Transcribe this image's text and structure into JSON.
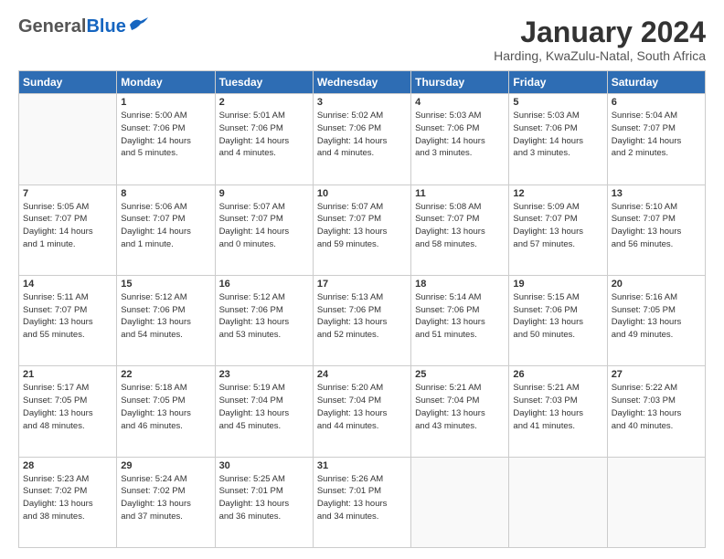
{
  "header": {
    "logo_general": "General",
    "logo_blue": "Blue",
    "month_title": "January 2024",
    "location": "Harding, KwaZulu-Natal, South Africa"
  },
  "days_of_week": [
    "Sunday",
    "Monday",
    "Tuesday",
    "Wednesday",
    "Thursday",
    "Friday",
    "Saturday"
  ],
  "weeks": [
    [
      {
        "day": "",
        "info": ""
      },
      {
        "day": "1",
        "info": "Sunrise: 5:00 AM\nSunset: 7:06 PM\nDaylight: 14 hours\nand 5 minutes."
      },
      {
        "day": "2",
        "info": "Sunrise: 5:01 AM\nSunset: 7:06 PM\nDaylight: 14 hours\nand 4 minutes."
      },
      {
        "day": "3",
        "info": "Sunrise: 5:02 AM\nSunset: 7:06 PM\nDaylight: 14 hours\nand 4 minutes."
      },
      {
        "day": "4",
        "info": "Sunrise: 5:03 AM\nSunset: 7:06 PM\nDaylight: 14 hours\nand 3 minutes."
      },
      {
        "day": "5",
        "info": "Sunrise: 5:03 AM\nSunset: 7:06 PM\nDaylight: 14 hours\nand 3 minutes."
      },
      {
        "day": "6",
        "info": "Sunrise: 5:04 AM\nSunset: 7:07 PM\nDaylight: 14 hours\nand 2 minutes."
      }
    ],
    [
      {
        "day": "7",
        "info": "Sunrise: 5:05 AM\nSunset: 7:07 PM\nDaylight: 14 hours\nand 1 minute."
      },
      {
        "day": "8",
        "info": "Sunrise: 5:06 AM\nSunset: 7:07 PM\nDaylight: 14 hours\nand 1 minute."
      },
      {
        "day": "9",
        "info": "Sunrise: 5:07 AM\nSunset: 7:07 PM\nDaylight: 14 hours\nand 0 minutes."
      },
      {
        "day": "10",
        "info": "Sunrise: 5:07 AM\nSunset: 7:07 PM\nDaylight: 13 hours\nand 59 minutes."
      },
      {
        "day": "11",
        "info": "Sunrise: 5:08 AM\nSunset: 7:07 PM\nDaylight: 13 hours\nand 58 minutes."
      },
      {
        "day": "12",
        "info": "Sunrise: 5:09 AM\nSunset: 7:07 PM\nDaylight: 13 hours\nand 57 minutes."
      },
      {
        "day": "13",
        "info": "Sunrise: 5:10 AM\nSunset: 7:07 PM\nDaylight: 13 hours\nand 56 minutes."
      }
    ],
    [
      {
        "day": "14",
        "info": "Sunrise: 5:11 AM\nSunset: 7:07 PM\nDaylight: 13 hours\nand 55 minutes."
      },
      {
        "day": "15",
        "info": "Sunrise: 5:12 AM\nSunset: 7:06 PM\nDaylight: 13 hours\nand 54 minutes."
      },
      {
        "day": "16",
        "info": "Sunrise: 5:12 AM\nSunset: 7:06 PM\nDaylight: 13 hours\nand 53 minutes."
      },
      {
        "day": "17",
        "info": "Sunrise: 5:13 AM\nSunset: 7:06 PM\nDaylight: 13 hours\nand 52 minutes."
      },
      {
        "day": "18",
        "info": "Sunrise: 5:14 AM\nSunset: 7:06 PM\nDaylight: 13 hours\nand 51 minutes."
      },
      {
        "day": "19",
        "info": "Sunrise: 5:15 AM\nSunset: 7:06 PM\nDaylight: 13 hours\nand 50 minutes."
      },
      {
        "day": "20",
        "info": "Sunrise: 5:16 AM\nSunset: 7:05 PM\nDaylight: 13 hours\nand 49 minutes."
      }
    ],
    [
      {
        "day": "21",
        "info": "Sunrise: 5:17 AM\nSunset: 7:05 PM\nDaylight: 13 hours\nand 48 minutes."
      },
      {
        "day": "22",
        "info": "Sunrise: 5:18 AM\nSunset: 7:05 PM\nDaylight: 13 hours\nand 46 minutes."
      },
      {
        "day": "23",
        "info": "Sunrise: 5:19 AM\nSunset: 7:04 PM\nDaylight: 13 hours\nand 45 minutes."
      },
      {
        "day": "24",
        "info": "Sunrise: 5:20 AM\nSunset: 7:04 PM\nDaylight: 13 hours\nand 44 minutes."
      },
      {
        "day": "25",
        "info": "Sunrise: 5:21 AM\nSunset: 7:04 PM\nDaylight: 13 hours\nand 43 minutes."
      },
      {
        "day": "26",
        "info": "Sunrise: 5:21 AM\nSunset: 7:03 PM\nDaylight: 13 hours\nand 41 minutes."
      },
      {
        "day": "27",
        "info": "Sunrise: 5:22 AM\nSunset: 7:03 PM\nDaylight: 13 hours\nand 40 minutes."
      }
    ],
    [
      {
        "day": "28",
        "info": "Sunrise: 5:23 AM\nSunset: 7:02 PM\nDaylight: 13 hours\nand 38 minutes."
      },
      {
        "day": "29",
        "info": "Sunrise: 5:24 AM\nSunset: 7:02 PM\nDaylight: 13 hours\nand 37 minutes."
      },
      {
        "day": "30",
        "info": "Sunrise: 5:25 AM\nSunset: 7:01 PM\nDaylight: 13 hours\nand 36 minutes."
      },
      {
        "day": "31",
        "info": "Sunrise: 5:26 AM\nSunset: 7:01 PM\nDaylight: 13 hours\nand 34 minutes."
      },
      {
        "day": "",
        "info": ""
      },
      {
        "day": "",
        "info": ""
      },
      {
        "day": "",
        "info": ""
      }
    ]
  ]
}
